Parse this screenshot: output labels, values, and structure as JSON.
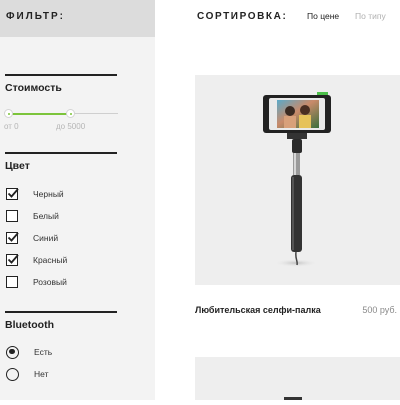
{
  "filter": {
    "title": "ФИЛЬТР:",
    "price": {
      "title": "Стоимость",
      "from_label": "от 0",
      "to_label": "до 5000",
      "selected_fraction": 0.56,
      "accent_color": "#7cc43b"
    },
    "color": {
      "title": "Цвет",
      "options": [
        {
          "label": "Черный",
          "checked": true
        },
        {
          "label": "Белый",
          "checked": false
        },
        {
          "label": "Синий",
          "checked": true
        },
        {
          "label": "Красный",
          "checked": true
        },
        {
          "label": "Розовый",
          "checked": false
        }
      ]
    },
    "bluetooth": {
      "title": "Bluetooth",
      "options": [
        {
          "label": "Есть",
          "selected": true
        },
        {
          "label": "Нет",
          "selected": false
        }
      ]
    }
  },
  "sort": {
    "title": "СОРТИРОВКА:",
    "options": [
      {
        "label": "По цене",
        "active": true
      },
      {
        "label": "По типу",
        "active": false
      }
    ]
  },
  "products": [
    {
      "name": "Любительская селфи-палка",
      "price": "500 руб."
    }
  ]
}
